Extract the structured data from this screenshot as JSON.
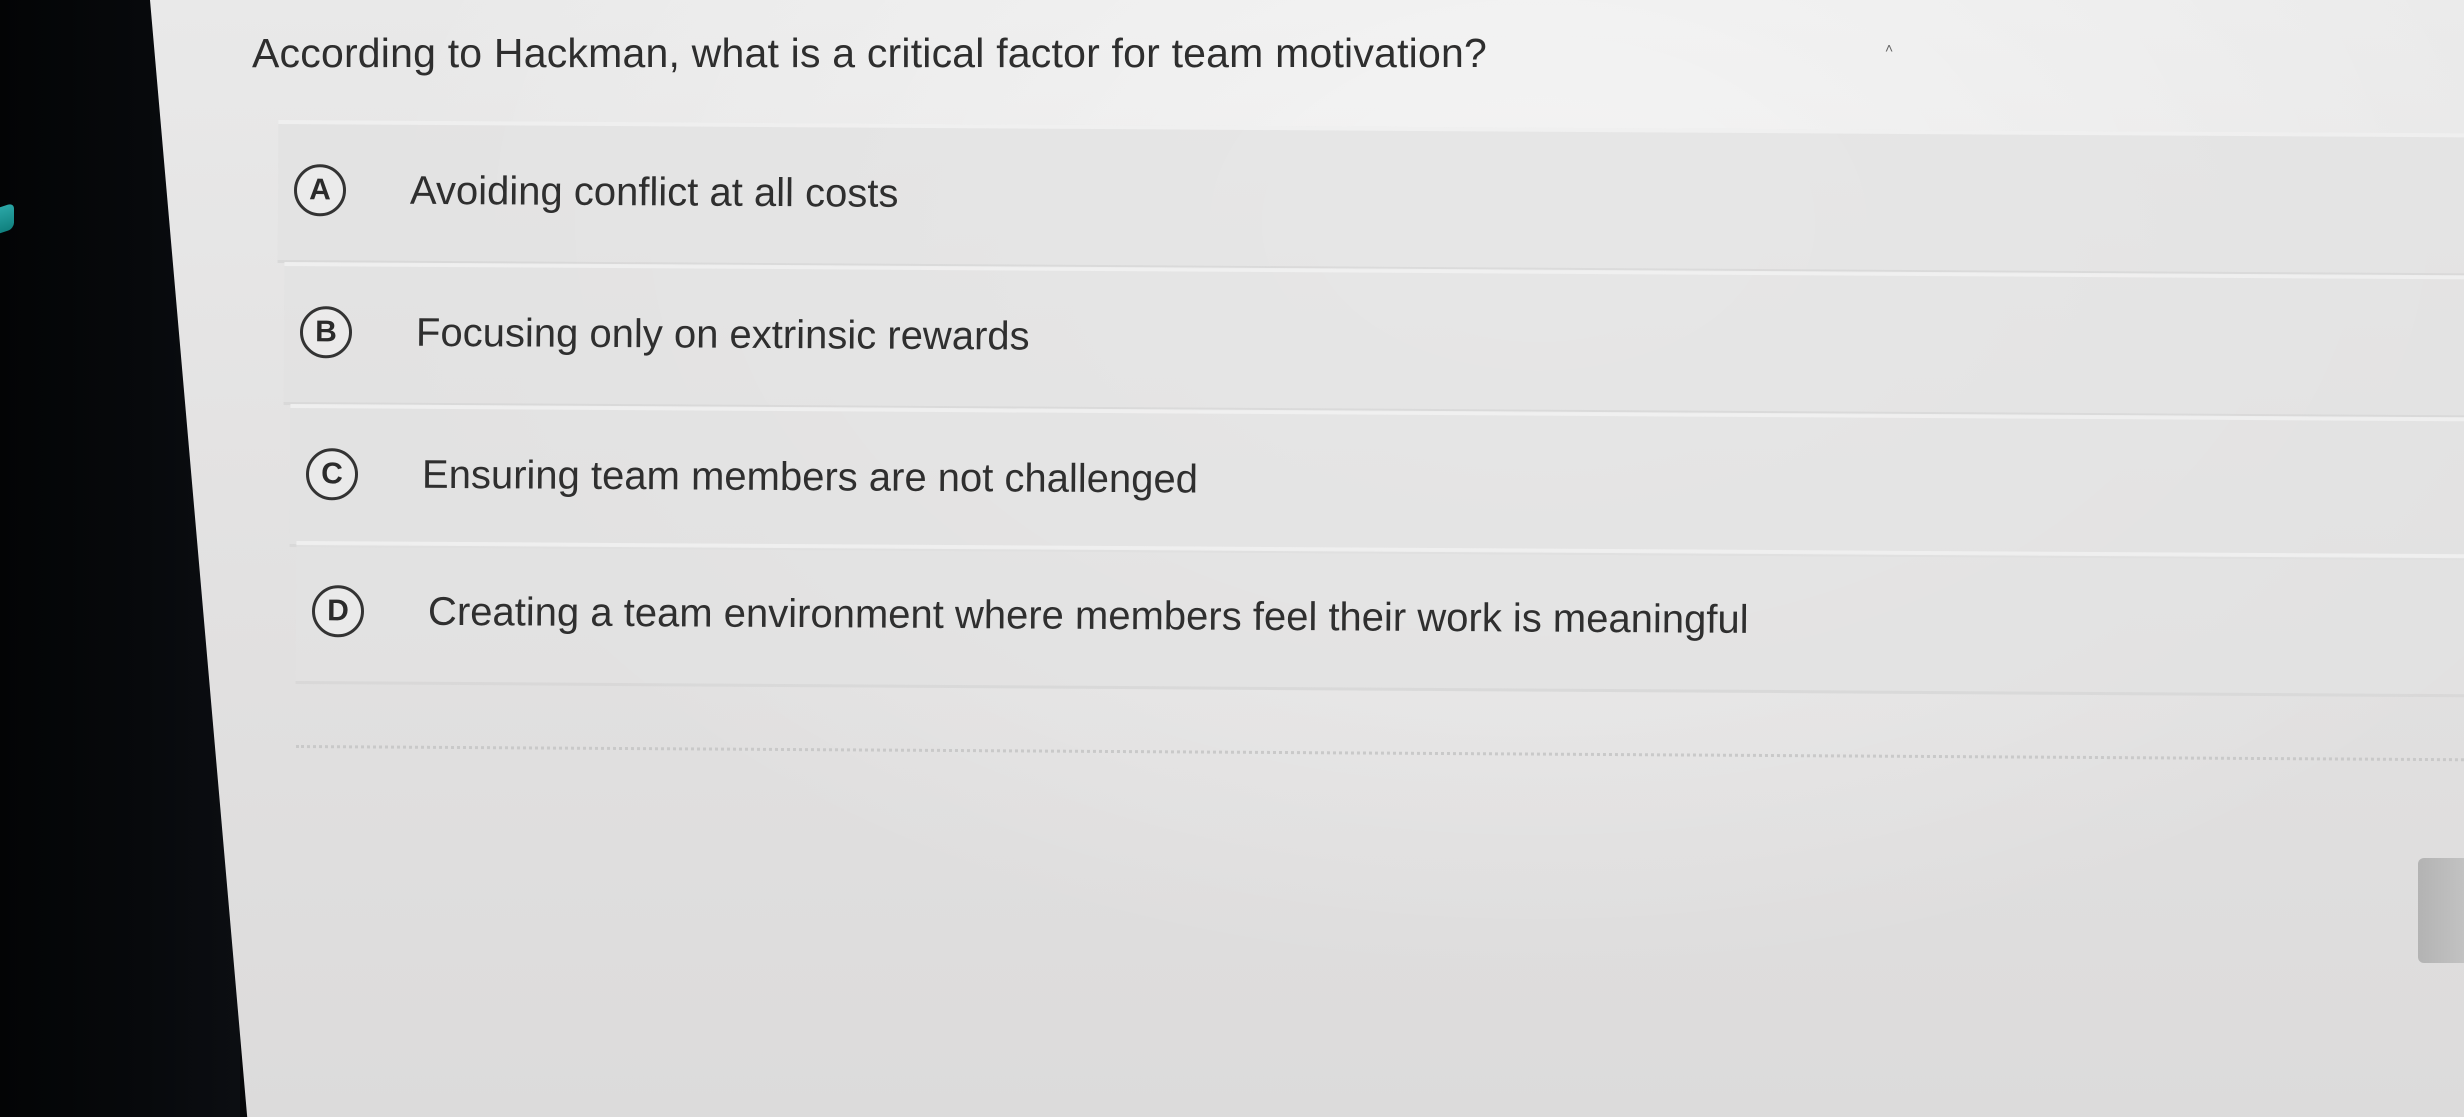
{
  "question": {
    "text": "According to Hackman, what is a critical factor for team motivation?"
  },
  "options": [
    {
      "letter": "A",
      "text": "Avoiding conflict at all costs"
    },
    {
      "letter": "B",
      "text": "Focusing only on extrinsic rewards"
    },
    {
      "letter": "C",
      "text": "Ensuring team members are not challenged"
    },
    {
      "letter": "D",
      "text": "Creating a team environment where members feel their work is meaningful"
    }
  ],
  "icons": {
    "collapse": "caret-up-icon"
  },
  "colors": {
    "page_background": "#e4e3e3",
    "option_background": "#e1e1e1",
    "text": "#2f2f2f",
    "badge_border": "#333333",
    "bezel": "#050608"
  }
}
